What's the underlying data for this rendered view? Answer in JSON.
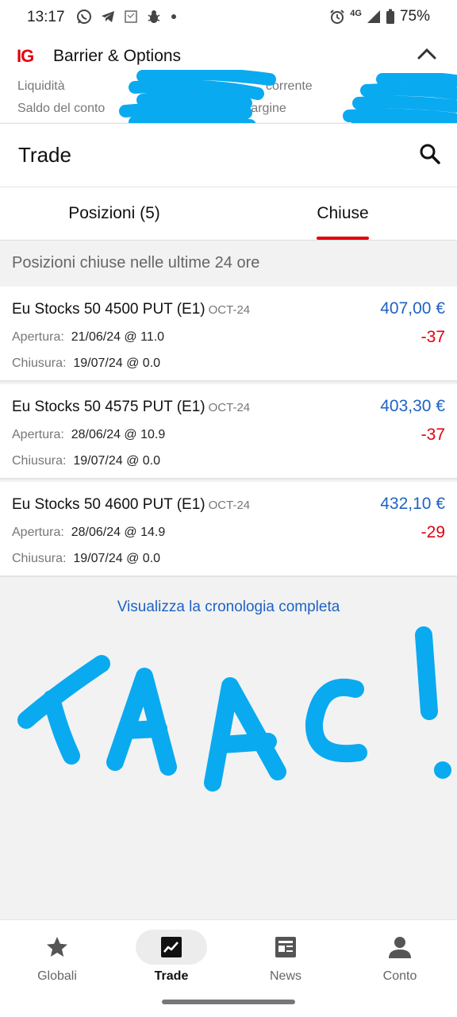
{
  "status_bar": {
    "time": "13:17",
    "network": "4G",
    "battery": "75%",
    "left_icons": [
      "whatsapp-icon",
      "telegram-icon",
      "app-icon",
      "bug-icon",
      "dot-icon"
    ],
    "right_icons": [
      "alarm-icon",
      "signal-icon",
      "battery-icon"
    ]
  },
  "account": {
    "logo": "IG",
    "name": "Barrier & Options",
    "labels": {
      "liquidity": "Liquidità",
      "current": "corrente",
      "balance": "Saldo del conto",
      "margin": "Margine"
    }
  },
  "trade": {
    "title": "Trade"
  },
  "tabs": [
    {
      "label": "Posizioni (5)",
      "active": false
    },
    {
      "label": "Chiuse",
      "active": true
    }
  ],
  "closed": {
    "section_title": "Posizioni chiuse nelle ultime 24 ore",
    "open_label": "Apertura:",
    "close_label": "Chiusura:",
    "positions": [
      {
        "name": "Eu Stocks 50 4500 PUT (E1)",
        "expiry": "OCT-24",
        "value": "407,00 €",
        "pl": "-37",
        "opened": "21/06/24 @ 11.0",
        "closed": "19/07/24 @ 0.0"
      },
      {
        "name": "Eu Stocks 50 4575 PUT (E1)",
        "expiry": "OCT-24",
        "value": "403,30 €",
        "pl": "-37",
        "opened": "28/06/24 @ 10.9",
        "closed": "19/07/24 @ 0.0"
      },
      {
        "name": "Eu Stocks 50 4600 PUT (E1)",
        "expiry": "OCT-24",
        "value": "432,10 €",
        "pl": "-29",
        "opened": "28/06/24 @ 14.9",
        "closed": "19/07/24 @ 0.0"
      }
    ],
    "history_link": "Visualizza la cronologia completa"
  },
  "annotation": {
    "text": "TAAC!",
    "color": "#0aaaf0"
  },
  "bottom_nav": [
    {
      "label": "Globali",
      "icon": "star-icon",
      "active": false
    },
    {
      "label": "Trade",
      "icon": "chart-icon",
      "active": true
    },
    {
      "label": "News",
      "icon": "newspaper-icon",
      "active": false
    },
    {
      "label": "Conto",
      "icon": "person-icon",
      "active": false
    }
  ],
  "colors": {
    "brand_red": "#e3000f",
    "link_blue": "#1e63c4",
    "loss_red": "#e3000f",
    "redaction": "#0aaaf0"
  }
}
